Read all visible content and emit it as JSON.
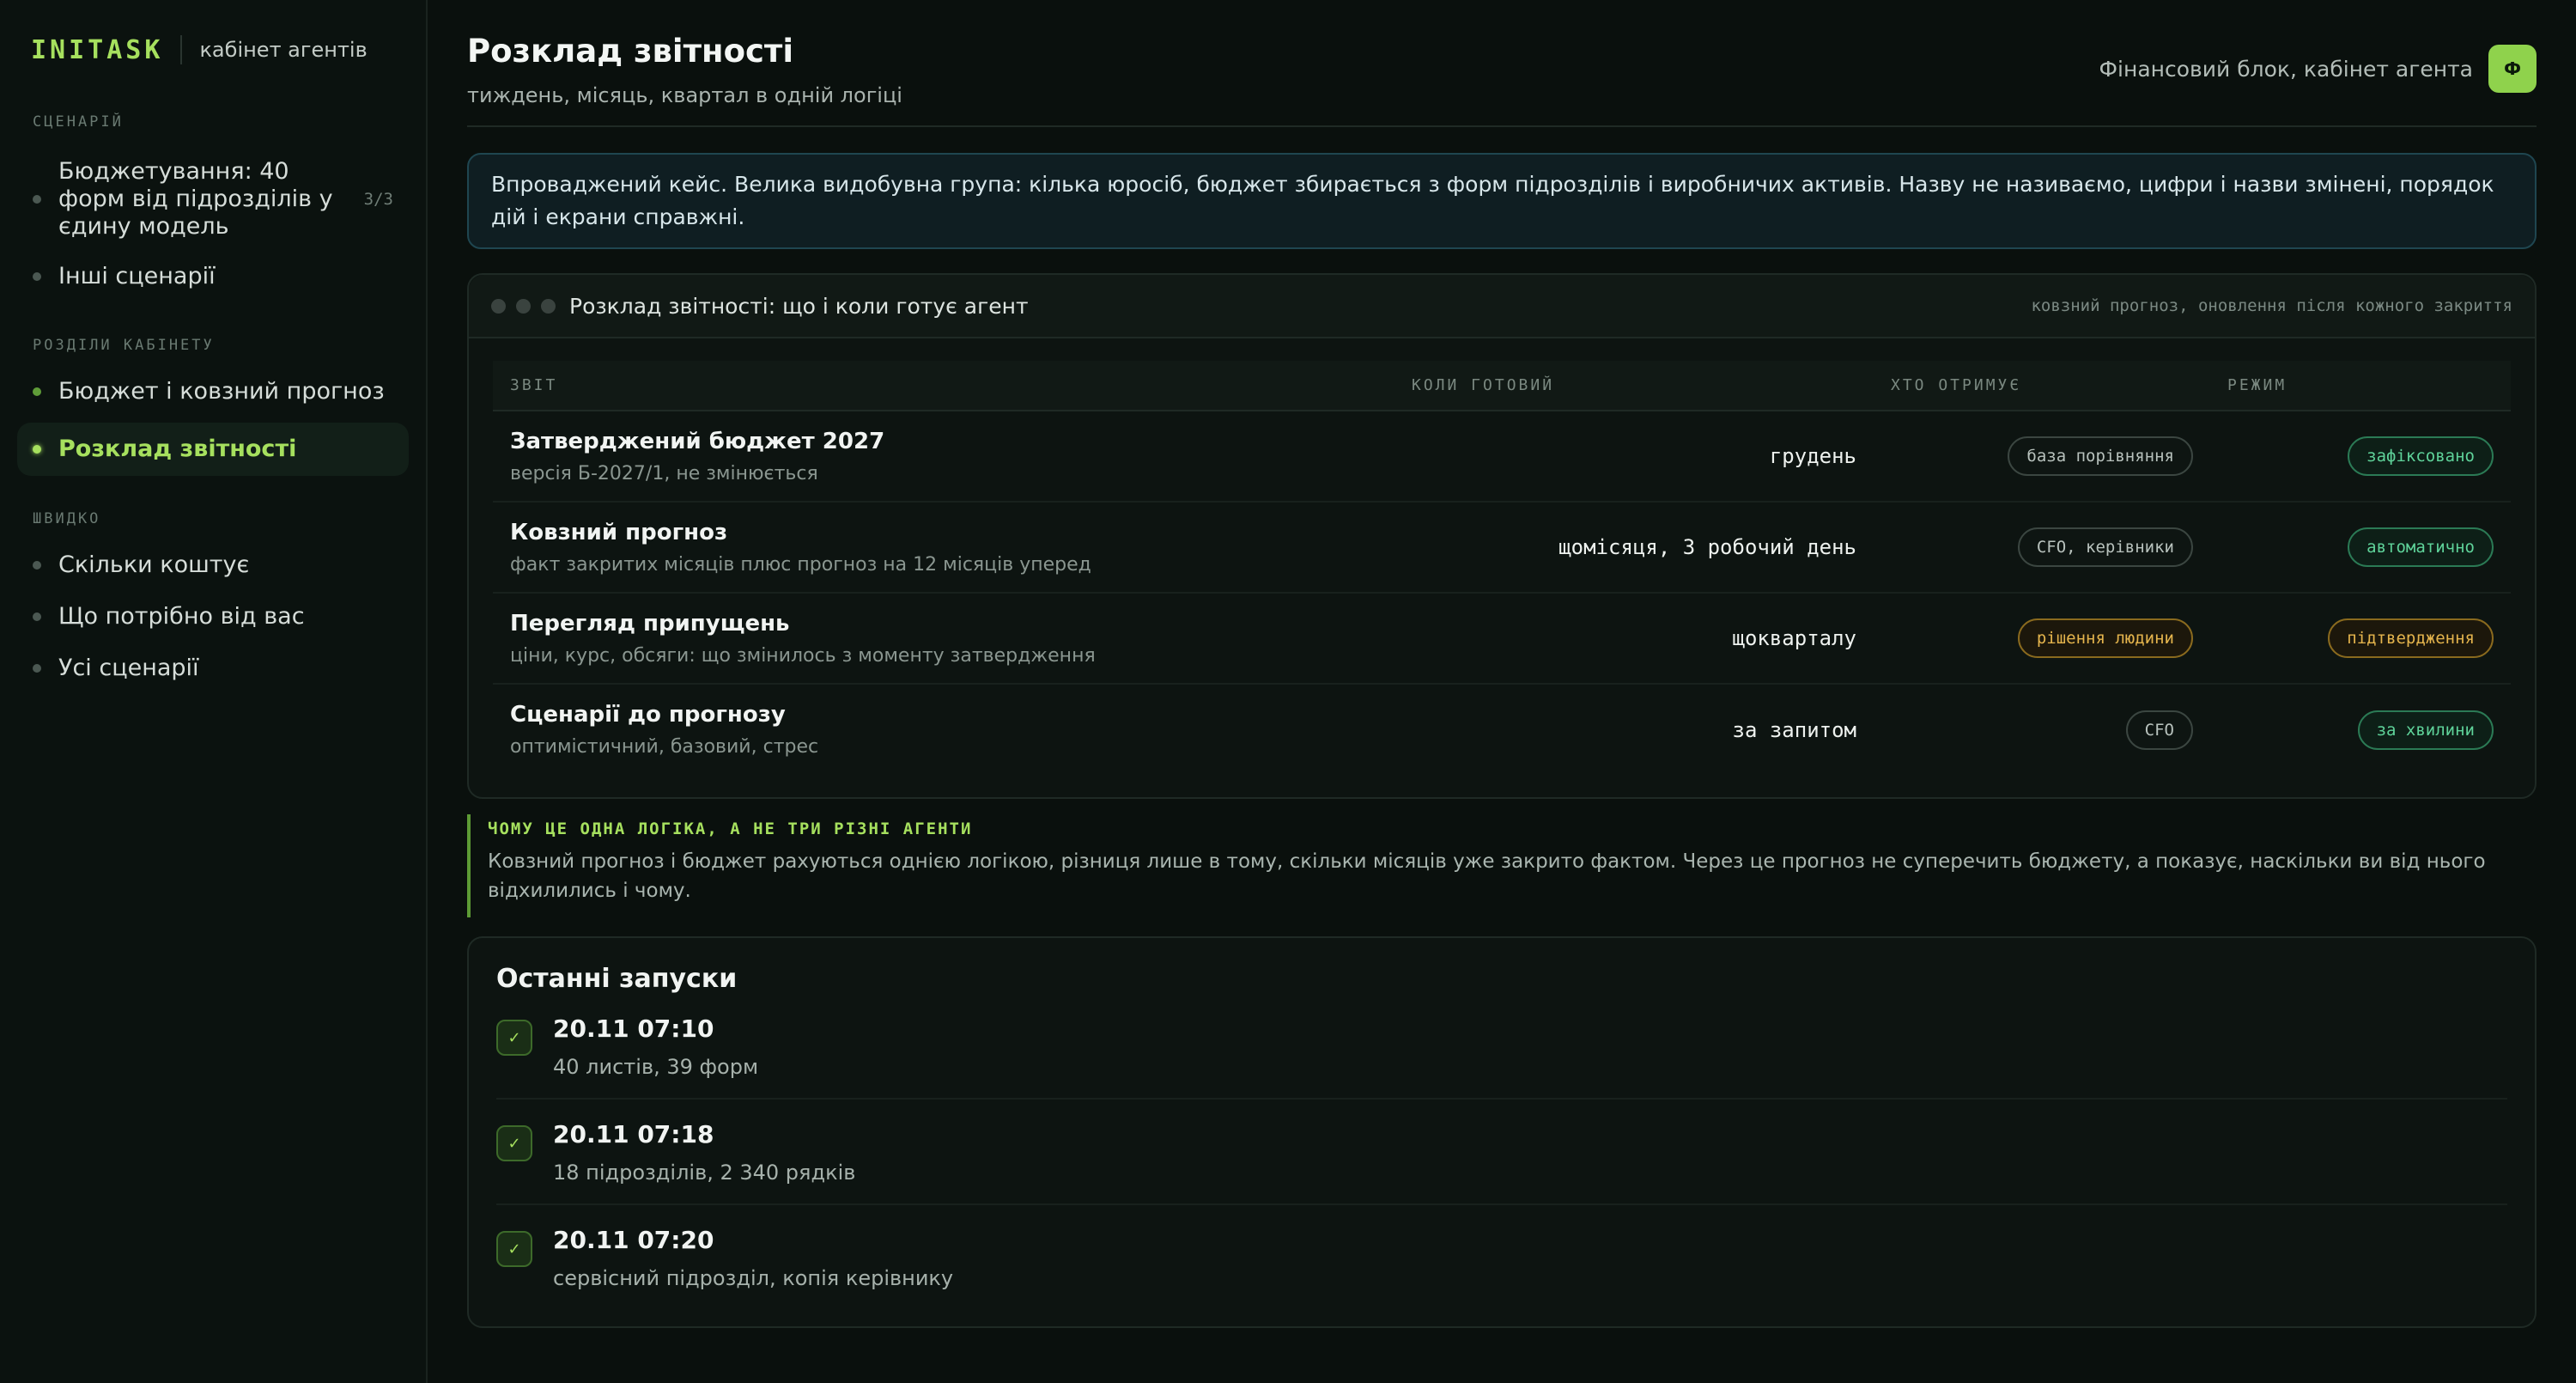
{
  "brand": {
    "name": "INITASK",
    "subtitle": "кабінет агентів"
  },
  "sidebar": {
    "scenarios_label": "СЦЕНАРІЙ",
    "scenarios": [
      {
        "label": "Бюджетування: 40 форм від підрозділів у єдину модель",
        "count": "3/3"
      },
      {
        "label": "Інші сценарії"
      }
    ],
    "sections_label": "РОЗДІЛИ КАБІНЕТУ",
    "sections": [
      {
        "label": "Бюджет і ковзний прогноз"
      },
      {
        "label": "Розклад звітності",
        "active": true
      }
    ],
    "quick_label": "ШВИДКО",
    "quick": [
      {
        "label": "Скільки коштує"
      },
      {
        "label": "Що потрібно від вас"
      },
      {
        "label": "Усі сценарії"
      }
    ]
  },
  "header": {
    "title": "Розклад звітності",
    "subtitle": "тиждень, місяць, квартал в одній логіці",
    "context": "Фінансовий блок, кабінет агента",
    "avatar": "Ф"
  },
  "banner": {
    "text": "Впроваджений кейс. Велика видобувна група: кілька юросіб, бюджет збирається з форм підрозділів і виробничих активів. Назву не називаємо, цифри і назви змінені, порядок дій і екрани справжні."
  },
  "schedule": {
    "title": "Розклад звітності: що і коли готує агент",
    "meta": "ковзний прогноз, оновлення після кожного закриття",
    "columns": [
      "ЗВІТ",
      "КОЛИ ГОТОВИЙ",
      "ХТО ОТРИМУЄ",
      "РЕЖИМ"
    ],
    "rows": [
      {
        "title": "Затверджений бюджет 2027",
        "desc": "версія Б-2027/1, не змінюється",
        "when": "грудень",
        "who": "база порівняння",
        "mode": "зафіксовано"
      },
      {
        "title": "Ковзний прогноз",
        "desc": "факт закритих місяців плюс прогноз на 12 місяців уперед",
        "when": "щомісяця, 3 робочий день",
        "who": "CFO, керівники",
        "mode": "автоматично"
      },
      {
        "title": "Перегляд припущень",
        "desc": "ціни, курс, обсяги: що змінилось з моменту затвердження",
        "when": "щокварталу",
        "who": "рішення людини",
        "mode": "підтвердження"
      },
      {
        "title": "Сценарії до прогнозу",
        "desc": "оптимістичний, базовий, стрес",
        "when": "за запитом",
        "who": "CFO",
        "mode": "за хвилини"
      }
    ]
  },
  "note": {
    "label": "ЧОМУ ЦЕ ОДНА ЛОГІКА, А НЕ ТРИ РІЗНІ АГЕНТИ",
    "text": "Ковзний прогноз і бюджет рахуються однією логікою, різниця лише в тому, скільки місяців уже закрито фактом. Через це прогноз не суперечить бюджету, а показує, наскільки ви від нього відхилились і чому."
  },
  "runs": {
    "title": "Останні запуски",
    "check": "✓",
    "items": [
      {
        "time": "20.11 07:10",
        "desc": "40 листів, 39 форм"
      },
      {
        "time": "20.11 07:18",
        "desc": "18 підрозділів, 2 340 рядків"
      },
      {
        "time": "20.11 07:20",
        "desc": "сервісний підрозділ, копія керівнику"
      }
    ]
  },
  "colors": {
    "accent": "#a6e05e",
    "amber": "#e5b54d",
    "green_status": "#5fd39a",
    "banner_border": "#1f4650"
  }
}
